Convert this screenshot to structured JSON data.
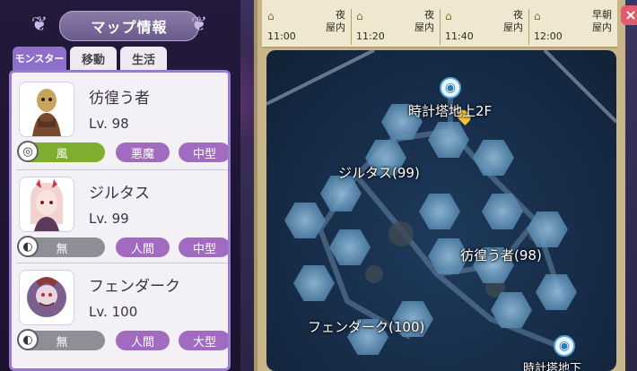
{
  "panel": {
    "title": "マップ情報",
    "tabs": [
      {
        "label": "モンスター",
        "active": true
      },
      {
        "label": "移動",
        "active": false
      },
      {
        "label": "生活",
        "active": false
      }
    ]
  },
  "monsters": [
    {
      "name": "彷徨う者",
      "level": "Lv. 98",
      "element": "風",
      "race": "悪魔",
      "size": "中型",
      "element_color": "#7fae2e"
    },
    {
      "name": "ジルタス",
      "level": "Lv. 99",
      "element": "無",
      "race": "人間",
      "size": "中型",
      "element_color": "#8f8d96"
    },
    {
      "name": "フェンダーク",
      "level": "Lv. 100",
      "element": "無",
      "race": "人間",
      "size": "大型",
      "element_color": "#8f8d96"
    }
  ],
  "timeline": [
    {
      "time": "11:00",
      "phase": "夜",
      "place": "屋内"
    },
    {
      "time": "11:20",
      "phase": "夜",
      "place": "屋内"
    },
    {
      "time": "11:40",
      "phase": "夜",
      "place": "屋内"
    },
    {
      "time": "12:00",
      "phase": "早朝",
      "place": "屋内"
    }
  ],
  "map": {
    "labels": {
      "tower_upper": "時計塔地上2F",
      "zirtas": "ジルタス(99)",
      "wanderer": "彷徨う者(98)",
      "fendark": "フェンダーク(100)",
      "tower_lower": "時計塔地下"
    }
  },
  "close_label": "×",
  "colors": {
    "accent": "#8e6fc9",
    "race_badge": "#a16cc0"
  }
}
